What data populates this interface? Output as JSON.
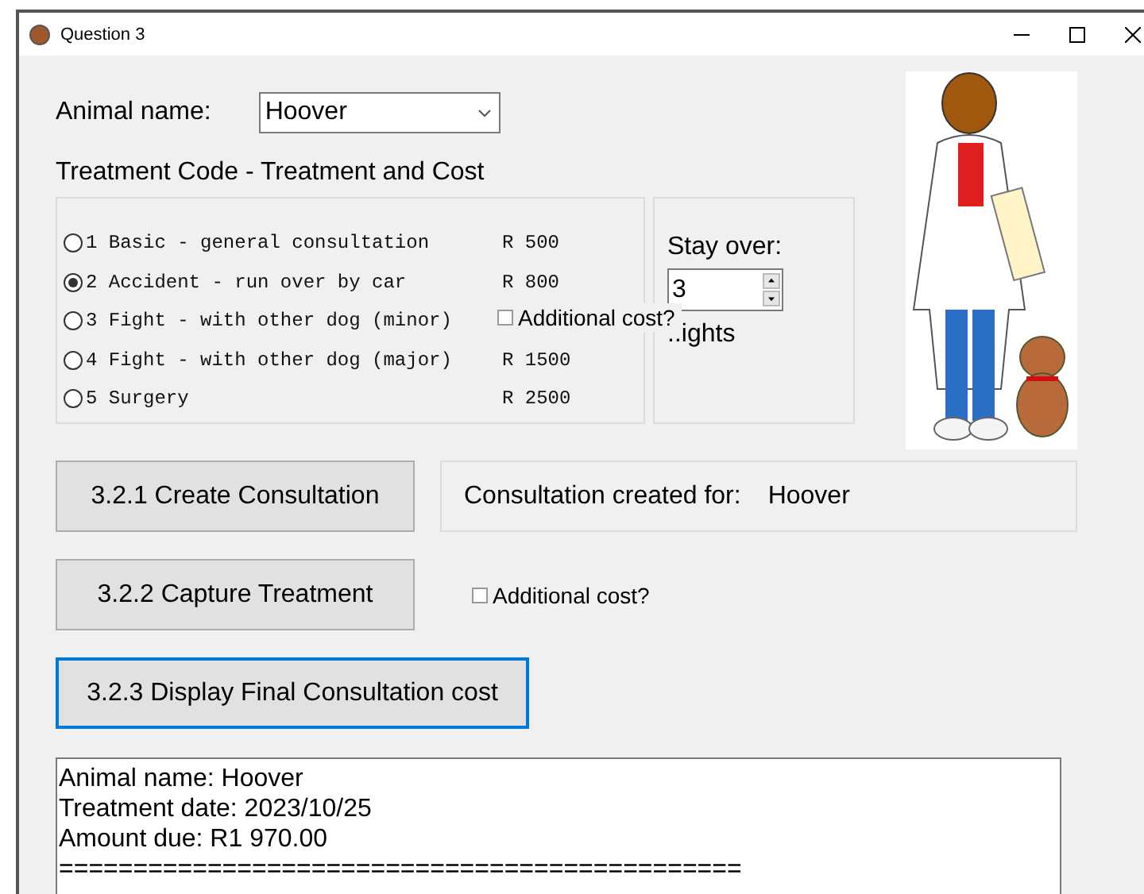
{
  "window": {
    "title": "Question 3"
  },
  "animal_name": {
    "label": "Animal name:",
    "value": "Hoover"
  },
  "treatment_heading": "Treatment Code - Treatment and Cost",
  "treatments": [
    {
      "label": "1 Basic - general consultation",
      "price": "R 500",
      "selected": false
    },
    {
      "label": "2 Accident - run over by car",
      "price": "R 800",
      "selected": true
    },
    {
      "label": "3 Fight - with other dog (minor)",
      "selected": false
    },
    {
      "label": "4 Fight - with other dog (major)",
      "price": "R 1500",
      "selected": false
    },
    {
      "label": "5 Surgery",
      "price": "R 2500",
      "selected": false
    }
  ],
  "overlay_checkbox": {
    "label": "Additional cost?",
    "checked": false
  },
  "stay": {
    "label": "Stay over:",
    "value": "3",
    "unit": "..ights"
  },
  "buttons": [
    {
      "label": "3.2.1 Create Consultation",
      "focused": false
    },
    {
      "label": "3.2.2 Capture Treatment",
      "focused": false
    },
    {
      "label": "3.2.3 Display Final Consultation cost",
      "focused": true
    }
  ],
  "status": {
    "label": "Consultation created for:",
    "value": "Hoover"
  },
  "additional_cost": {
    "label": "Additional cost?",
    "checked": false
  },
  "output_lines": [
    "Animal name: Hoover",
    "Treatment date: 2023/10/25",
    "Amount due: R1 970.00",
    "=============================================="
  ]
}
